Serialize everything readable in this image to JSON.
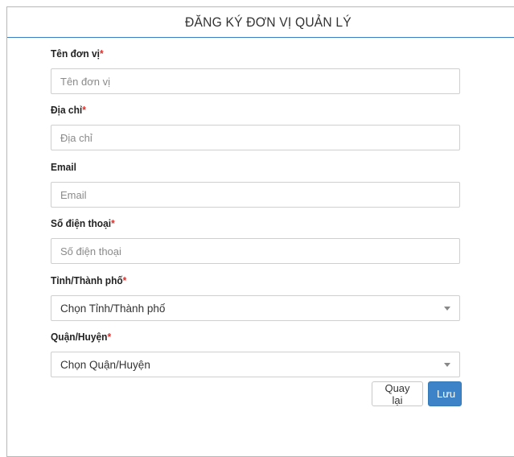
{
  "header": {
    "title": "ĐĂNG KÝ ĐƠN VỊ QUẢN LÝ"
  },
  "colors": {
    "accent": "#3a7fc4",
    "required": "#d9302b",
    "primary_button": "#3c84c7"
  },
  "form": {
    "required_mark": "*",
    "fields": [
      {
        "label": "Tên đơn vị",
        "required": true,
        "placeholder": "Tên đơn vị",
        "value": ""
      },
      {
        "label": "Địa chỉ",
        "required": true,
        "placeholder": "Địa chỉ",
        "value": ""
      },
      {
        "label": "Email",
        "required": false,
        "placeholder": "Email",
        "value": ""
      },
      {
        "label": "Số điện thoại",
        "required": true,
        "placeholder": "Số điện thoại",
        "value": ""
      }
    ],
    "selects": [
      {
        "label": "Tỉnh/Thành phố",
        "required": true,
        "selected": "Chọn Tỉnh/Thành phố"
      },
      {
        "label": "Quận/Huyện",
        "required": true,
        "selected": "Chọn Quận/Huyện"
      }
    ]
  },
  "actions": {
    "back_label": "Quay lại",
    "save_label": "Lưu"
  }
}
